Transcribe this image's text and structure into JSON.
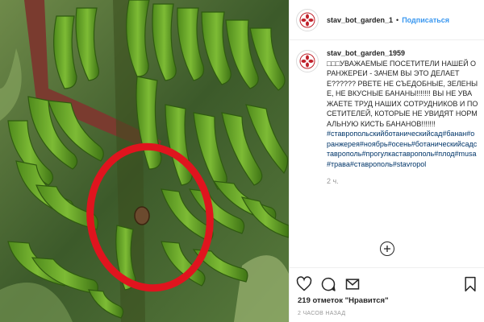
{
  "post": {
    "photo_alt": "Гроздь зелёных бананов, часть плодов сорвана (обведено красным)"
  },
  "header": {
    "username": "stav_bot_garden_1",
    "separator": "•",
    "follow_label": "Подписаться"
  },
  "caption": {
    "username": "stav_bot_garden_1959",
    "text": "□□□УВАЖАЕМЫЕ ПОСЕТИТЕЛИ НАШЕЙ ОРАНЖЕРЕИ - ЗАЧЕМ ВЫ ЭТО ДЕЛАЕТЕ?????? РВЕТЕ НЕ СЪЕДОБНЫЕ, ЗЕЛЕНЫЕ, НЕ ВКУСНЫЕ БАНАНЫ!!!!!!! ВЫ НЕ УВАЖАЕТЕ ТРУД НАШИХ СОТРУДНИКОВ И ПОСЕТИТЕЛЕЙ, КОТОРЫЕ НЕ УВИДЯТ НОРМАЛЬНУЮ КИСТЬ БАНАНОВ!!!!!!!",
    "hashtags": "#ставропольскийботаническийсад#банан#оранжерея#ноябрь#осень#ботаническийсадставрополь#прогулкаставрополь#плод#musa#трава#ставрополь#stavropol",
    "age": "2 ч."
  },
  "actions": {
    "like_icon": "heart-icon",
    "comment_icon": "comment-icon",
    "share_icon": "share-icon",
    "save_icon": "bookmark-icon",
    "load_more_icon": "plus-circle-icon"
  },
  "stats": {
    "likes": "219 отметок \"Нравится\"",
    "time": "2 ЧАСОВ НАЗАД"
  },
  "colors": {
    "link": "#3897f0",
    "hashtag": "#003569",
    "circle": "#e0141e"
  }
}
